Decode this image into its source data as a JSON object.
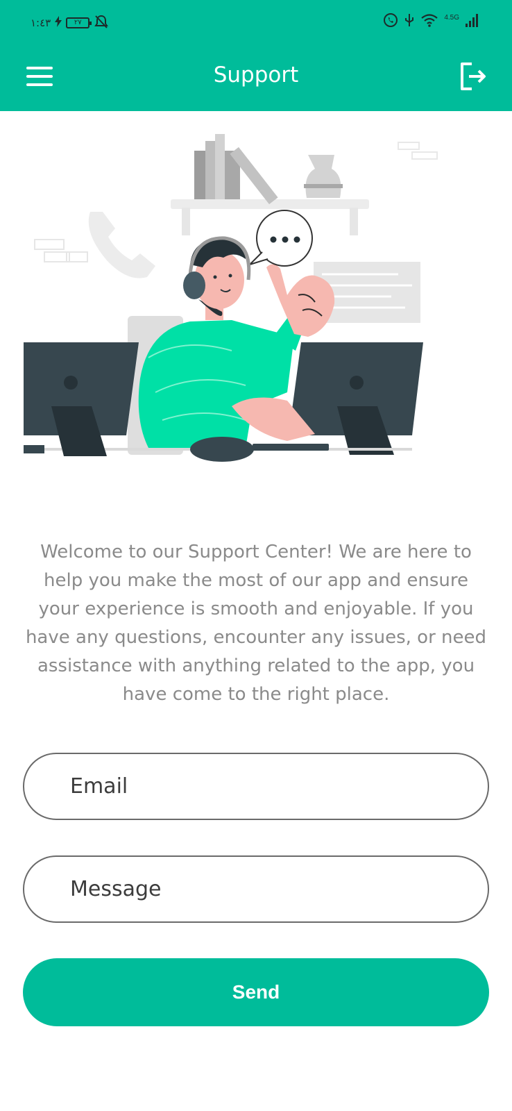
{
  "status_bar": {
    "time": "١:٤٣",
    "battery": "٢٧",
    "network": "4.5G"
  },
  "header": {
    "title": "Support",
    "menu_icon": "hamburger-menu-icon",
    "logout_icon": "logout-icon"
  },
  "illustration": {
    "icon": "support-agent-illustration"
  },
  "main": {
    "welcome_text": "Welcome to our Support Center! We are here to help you make the most of our app and ensure your experience is smooth and enjoyable. If you have any questions, encounter any issues, or need assistance with anything related to the app, you have come to the right place."
  },
  "form": {
    "email_placeholder": "Email",
    "message_placeholder": "Message",
    "send_label": "Send"
  },
  "colors": {
    "accent": "#00bc9a",
    "text_muted": "#8a8a8a"
  }
}
